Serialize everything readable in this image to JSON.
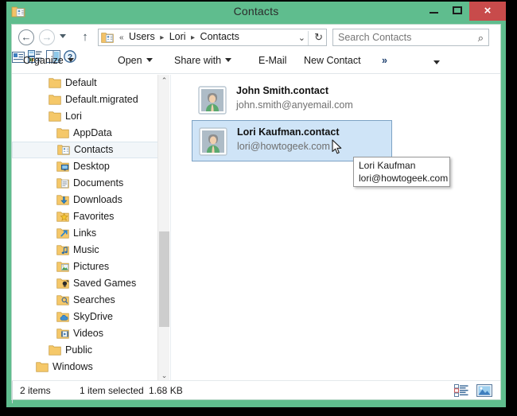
{
  "window": {
    "title": "Contacts",
    "icon": "contacts-folder-icon",
    "controls": {
      "minimize": "minimize-button",
      "maximize": "maximize-button",
      "close": "×"
    },
    "accent_green": "#5fbd8e",
    "close_red": "#c84b4b"
  },
  "addressbar": {
    "back": "←",
    "forward": "→",
    "up": "↑",
    "breadcrumb": {
      "prefix": "«",
      "segments": [
        "Users",
        "Lori",
        "Contacts"
      ],
      "separator": "▸",
      "dropdown": "⌄",
      "refresh": "↻"
    },
    "search": {
      "placeholder": "Search Contacts",
      "value": "",
      "icon": "⌕"
    }
  },
  "toolbar": {
    "organize": "Organize",
    "open": "Open",
    "share_with": "Share with",
    "email": "E-Mail",
    "new_contact": "New Contact",
    "overflow": "»",
    "view_options": "view-options-icon",
    "preview_pane": "preview-pane-icon",
    "help": "help-icon"
  },
  "navpane": {
    "items": [
      {
        "label": "Default",
        "indent": 46,
        "icon": "folder",
        "selected": false
      },
      {
        "label": "Default.migrated",
        "indent": 46,
        "icon": "folder",
        "selected": false
      },
      {
        "label": "Lori",
        "indent": 46,
        "icon": "folder",
        "selected": false
      },
      {
        "label": "AppData",
        "indent": 56,
        "icon": "folder",
        "selected": false
      },
      {
        "label": "Contacts",
        "indent": 56,
        "icon": "contacts",
        "selected": true
      },
      {
        "label": "Desktop",
        "indent": 56,
        "icon": "desktop",
        "selected": false
      },
      {
        "label": "Documents",
        "indent": 56,
        "icon": "documents",
        "selected": false
      },
      {
        "label": "Downloads",
        "indent": 56,
        "icon": "downloads",
        "selected": false
      },
      {
        "label": "Favorites",
        "indent": 56,
        "icon": "favorites",
        "selected": false
      },
      {
        "label": "Links",
        "indent": 56,
        "icon": "links",
        "selected": false
      },
      {
        "label": "Music",
        "indent": 56,
        "icon": "music",
        "selected": false
      },
      {
        "label": "Pictures",
        "indent": 56,
        "icon": "pictures",
        "selected": false
      },
      {
        "label": "Saved Games",
        "indent": 56,
        "icon": "savedgames",
        "selected": false
      },
      {
        "label": "Searches",
        "indent": 56,
        "icon": "searches",
        "selected": false
      },
      {
        "label": "SkyDrive",
        "indent": 56,
        "icon": "skydrive",
        "selected": false
      },
      {
        "label": "Videos",
        "indent": 56,
        "icon": "videos",
        "selected": false
      },
      {
        "label": "Public",
        "indent": 46,
        "icon": "folder",
        "selected": false
      },
      {
        "label": "Windows",
        "indent": 30,
        "icon": "folder",
        "selected": false
      }
    ],
    "scrollbar": {
      "up": "⌃",
      "down": "⌄"
    }
  },
  "filepane": {
    "items": [
      {
        "name": "John Smith.contact",
        "email": "john.smith@anyemail.com",
        "selected": false
      },
      {
        "name": "Lori Kaufman.contact",
        "email": "lori@howtogeek.com",
        "selected": true
      }
    ]
  },
  "tooltip": {
    "name": "Lori Kaufman",
    "email": "lori@howtogeek.com"
  },
  "statusbar": {
    "count": "2 items",
    "selection": "1 item selected",
    "size": "1.68 KB",
    "view_details": "details-view-icon",
    "view_large": "large-icons-view-icon"
  }
}
